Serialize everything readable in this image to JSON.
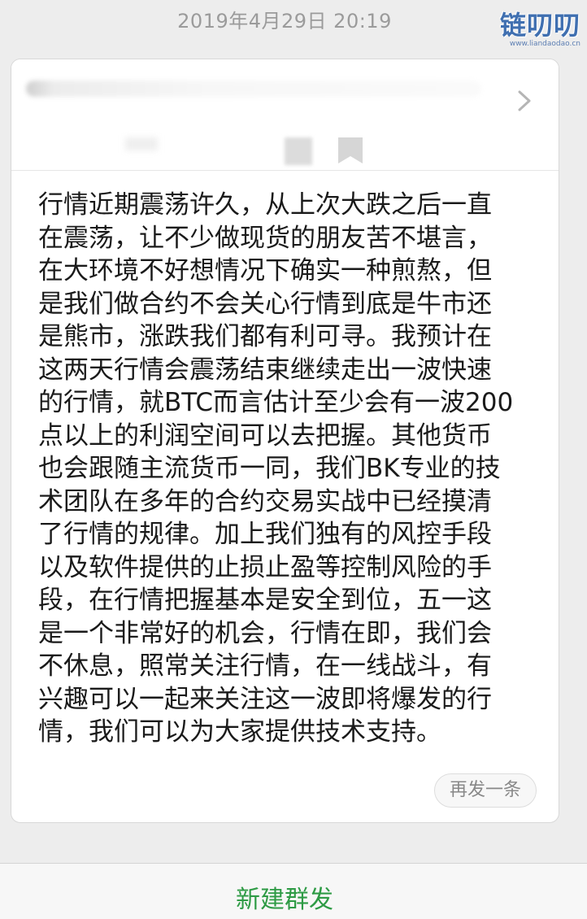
{
  "timestamp": "2019年4月29日 20:19",
  "watermark": {
    "text": "链叨叨",
    "subtext": "www.liandaodao.cn"
  },
  "message": {
    "lines": [
      "行情近期震荡许久，从上次大跌之后一直",
      "在震荡，让不少做现货的朋友苦不堪言，",
      "在大环境不好想情况下确实一种煎熬，但",
      "是我们做合约不会关心行情到底是牛市还",
      "是熊市，涨跌我们都有利可寻。我预计在",
      "这两天行情会震荡结束继续走出一波快速",
      "的行情，就BTC而言估计至少会有一波200",
      "点以上的利润空间可以去把握。其他货币",
      "也会跟随主流货币一同，我们BK专业的技",
      "术团队在多年的合约交易实战中已经摸清",
      "了行情的规律。加上我们独有的风控手段",
      "以及软件提供的止损止盈等控制风险的手",
      "段，在行情把握基本是安全到位，五一这",
      "是一个非常好的机会，行情在即，我们会",
      "不休息，照常关注行情，在一线战斗，有",
      "兴趣可以一起来关注这一波即将爆发的行",
      "情，我们可以为大家提供技术支持。"
    ]
  },
  "resend_label": "再发一条",
  "bottom": {
    "new_broadcast_label": "新建群发"
  },
  "colors": {
    "accent_green": "#2e9b45",
    "watermark_blue": "#3f6fb0"
  }
}
